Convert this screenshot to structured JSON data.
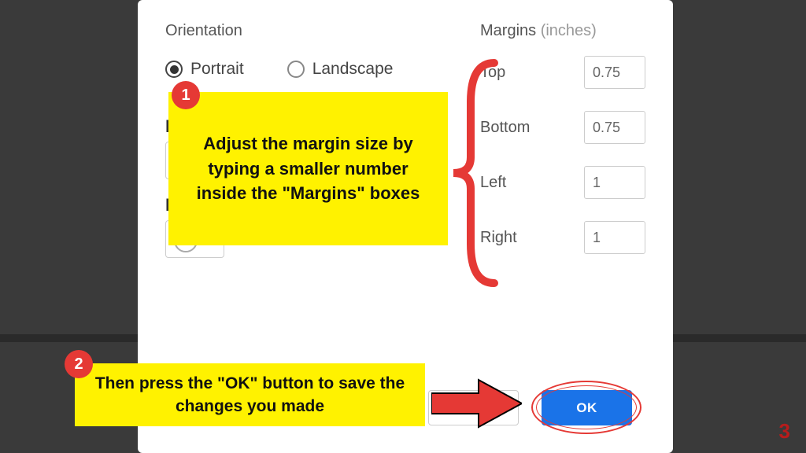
{
  "orientation": {
    "header": "Orientation",
    "portrait": "Portrait",
    "landscape": "Landscape"
  },
  "margins": {
    "header": "Margins",
    "unit": "(inches)",
    "top_label": "Top",
    "bottom_label": "Bottom",
    "left_label": "Left",
    "right_label": "Right",
    "top": "0.75",
    "bottom": "0.75",
    "left": "1",
    "right": "1"
  },
  "buttons": {
    "ok": "OK"
  },
  "callouts": {
    "c1": "Adjust the margin size by typing a smaller number inside the \"Margins\" boxes",
    "c2": "Then press the \"OK\" button to save the changes you made",
    "badge1": "1",
    "badge2": "2"
  },
  "peek": {
    "p_letter": "P"
  },
  "page_number": "3"
}
